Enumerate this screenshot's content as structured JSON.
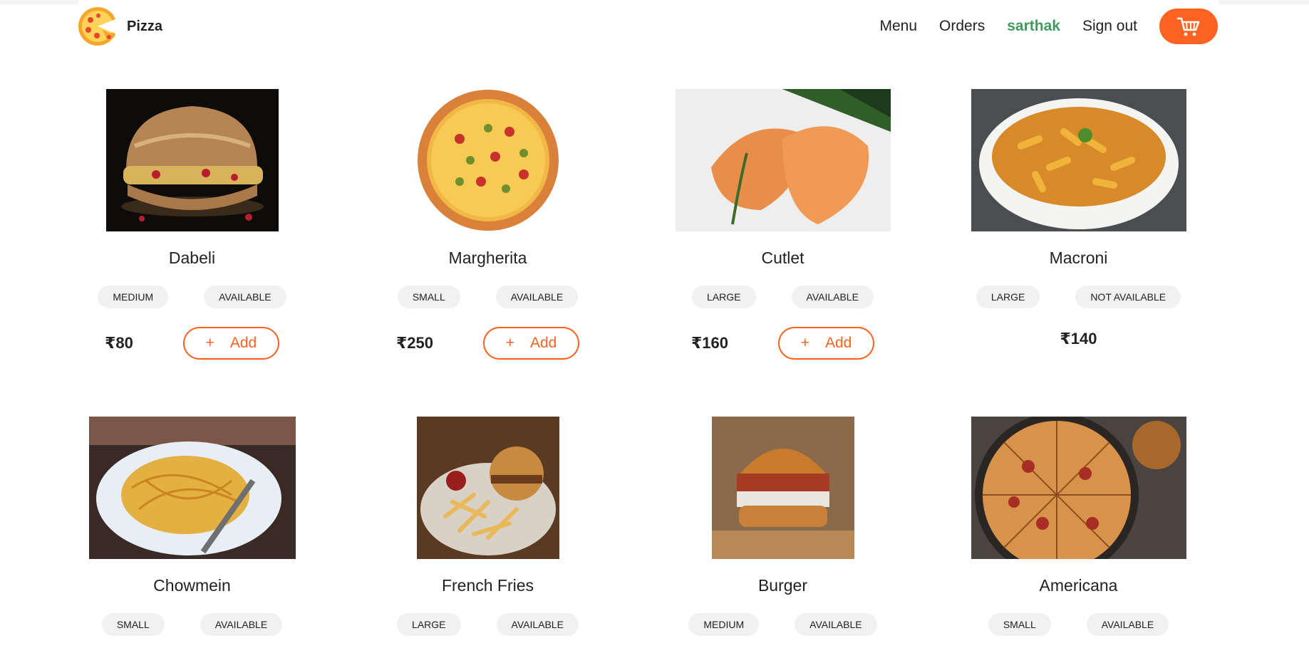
{
  "brand": {
    "name": "Pizza",
    "logo_icon": "pizza-logo-icon"
  },
  "nav": {
    "links": [
      "Menu",
      "Orders"
    ],
    "user": "sarthak",
    "signout": "Sign out",
    "cart_icon": "cart-icon"
  },
  "colors": {
    "accent": "#fd6220",
    "user": "#3f9b5f",
    "tag_bg": "#f1f1f1"
  },
  "menu": [
    {
      "name": "Dabeli",
      "size": "MEDIUM",
      "status": "AVAILABLE",
      "price": "₹80",
      "add": "Add",
      "plus": "+",
      "image": "dabeli-image"
    },
    {
      "name": "Margherita",
      "size": "SMALL",
      "status": "AVAILABLE",
      "price": "₹250",
      "add": "Add",
      "plus": "+",
      "image": "margherita-image"
    },
    {
      "name": "Cutlet",
      "size": "LARGE",
      "status": "AVAILABLE",
      "price": "₹160",
      "add": "Add",
      "plus": "+",
      "image": "cutlet-image"
    },
    {
      "name": "Macroni",
      "size": "LARGE",
      "status": "NOT AVAILABLE",
      "price": "₹140",
      "image": "macroni-image"
    },
    {
      "name": "Chowmein",
      "size": "SMALL",
      "status": "AVAILABLE",
      "image": "chowmein-image"
    },
    {
      "name": "French Fries",
      "size": "LARGE",
      "status": "AVAILABLE",
      "image": "french-fries-image"
    },
    {
      "name": "Burger",
      "size": "MEDIUM",
      "status": "AVAILABLE",
      "image": "burger-image"
    },
    {
      "name": "Americana",
      "size": "SMALL",
      "status": "AVAILABLE",
      "image": "americana-image"
    }
  ]
}
